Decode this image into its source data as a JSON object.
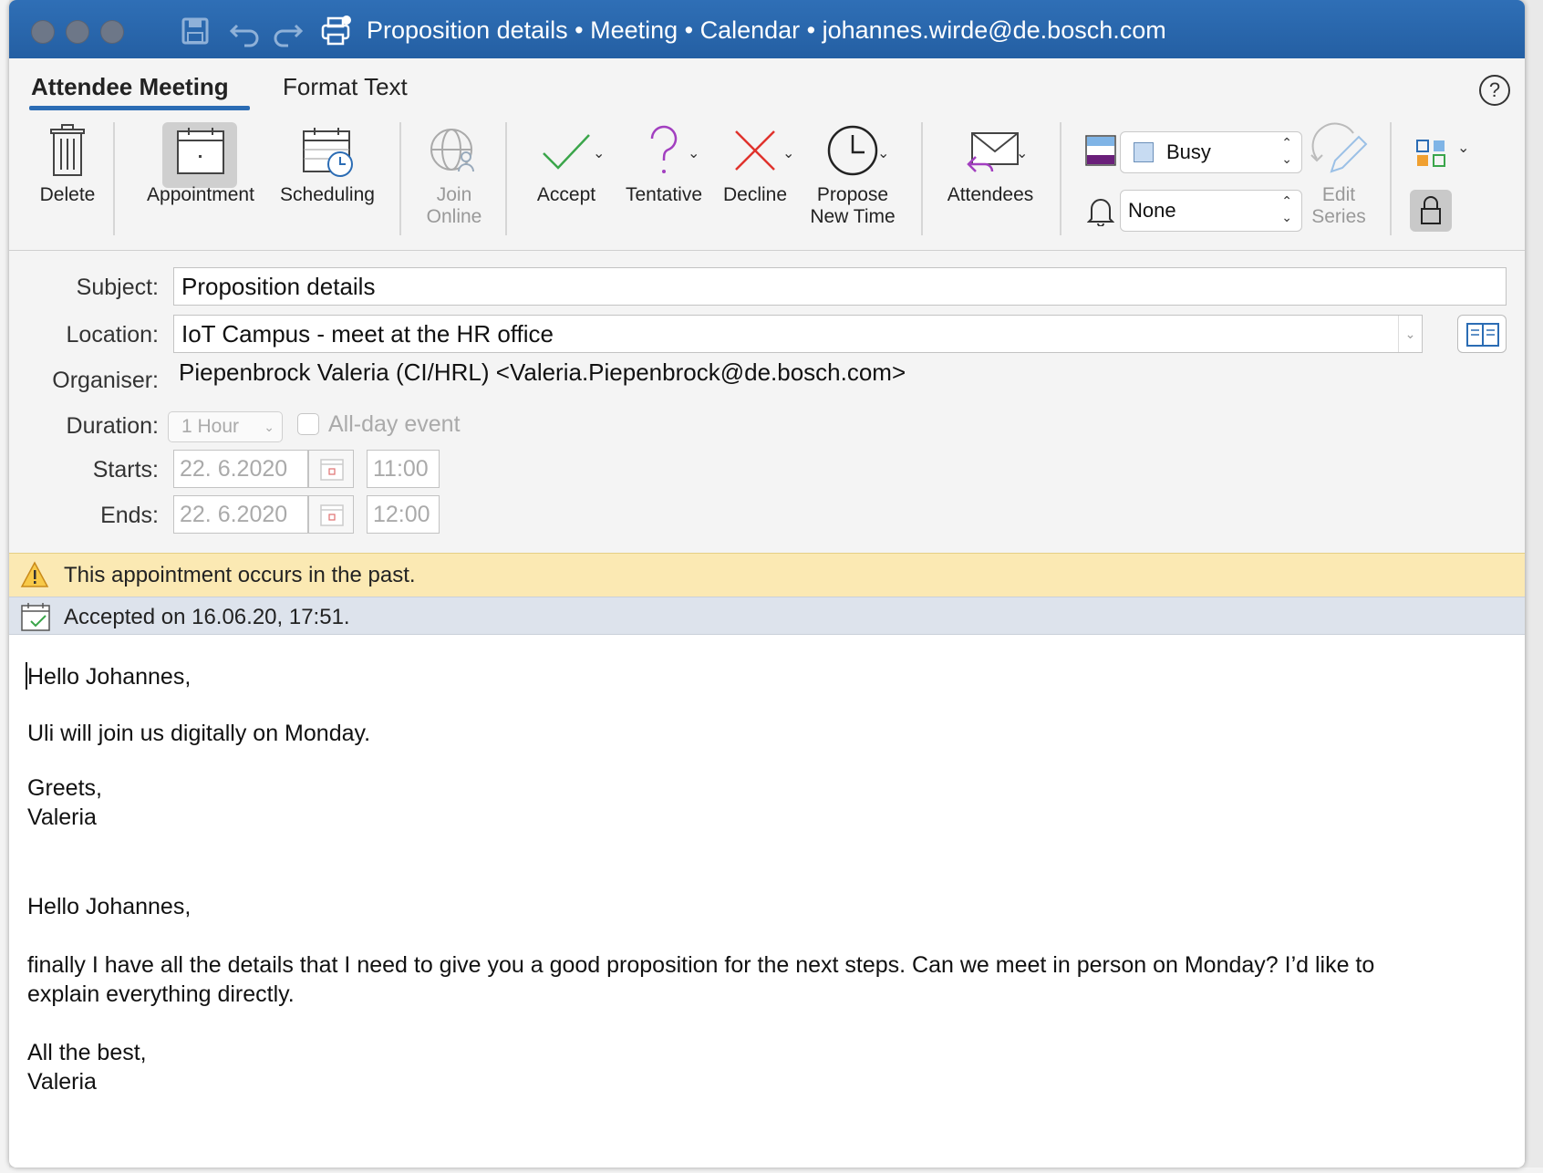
{
  "window": {
    "title": "Proposition details • Meeting • Calendar • johannes.wirde@de.bosch.com"
  },
  "tabs": [
    {
      "label": "Attendee Meeting",
      "active": true
    },
    {
      "label": "Format Text",
      "active": false
    }
  ],
  "help_label": "?",
  "ribbon": {
    "delete": "Delete",
    "appointment": "Appointment",
    "scheduling": "Scheduling",
    "join_online": [
      "Join",
      "Online"
    ],
    "accept": "Accept",
    "tentative": "Tentative",
    "decline": "Decline",
    "propose_new_time": [
      "Propose",
      "New Time"
    ],
    "attendees": "Attendees",
    "show_as": "Busy",
    "reminder": "None",
    "edit_series": [
      "Edit",
      "Series"
    ]
  },
  "form": {
    "subject_label": "Subject:",
    "subject_value": "Proposition details",
    "location_label": "Location:",
    "location_value": "IoT Campus - meet at the HR office",
    "organiser_label": "Organiser:",
    "organiser_value": "Piepenbrock Valeria (CI/HRL) <Valeria.Piepenbrock@de.bosch.com>",
    "duration_label": "Duration:",
    "duration_value": "1 Hour",
    "all_day_label": "All-day event",
    "starts_label": "Starts:",
    "starts_date": "22.  6.2020",
    "starts_time": "11:00",
    "ends_label": "Ends:",
    "ends_date": "22.  6.2020",
    "ends_time": "12:00"
  },
  "notices": {
    "past_warning": "This appointment occurs in the past.",
    "accepted": "Accepted on 16.06.20, 17:51."
  },
  "body": {
    "lines": [
      "Hello Johannes,",
      "Uli will join us digitally on Monday.",
      "Greets,",
      "Valeria",
      "Hello Johannes,",
      "finally I have all the details that I need to give you a good proposition for the next steps. Can we meet in person on Monday? I’d like to",
      "explain everything directly.",
      "All the best,",
      "Valeria"
    ]
  },
  "colors": {
    "titlebar": "#2a66ad",
    "accent": "#2b6cb4",
    "warning_bg": "#fbe9b3",
    "accepted_bg": "#dde3ec",
    "accept_green": "#3aa54a",
    "tentative_purple": "#a23fc0",
    "decline_red": "#e0322c"
  }
}
